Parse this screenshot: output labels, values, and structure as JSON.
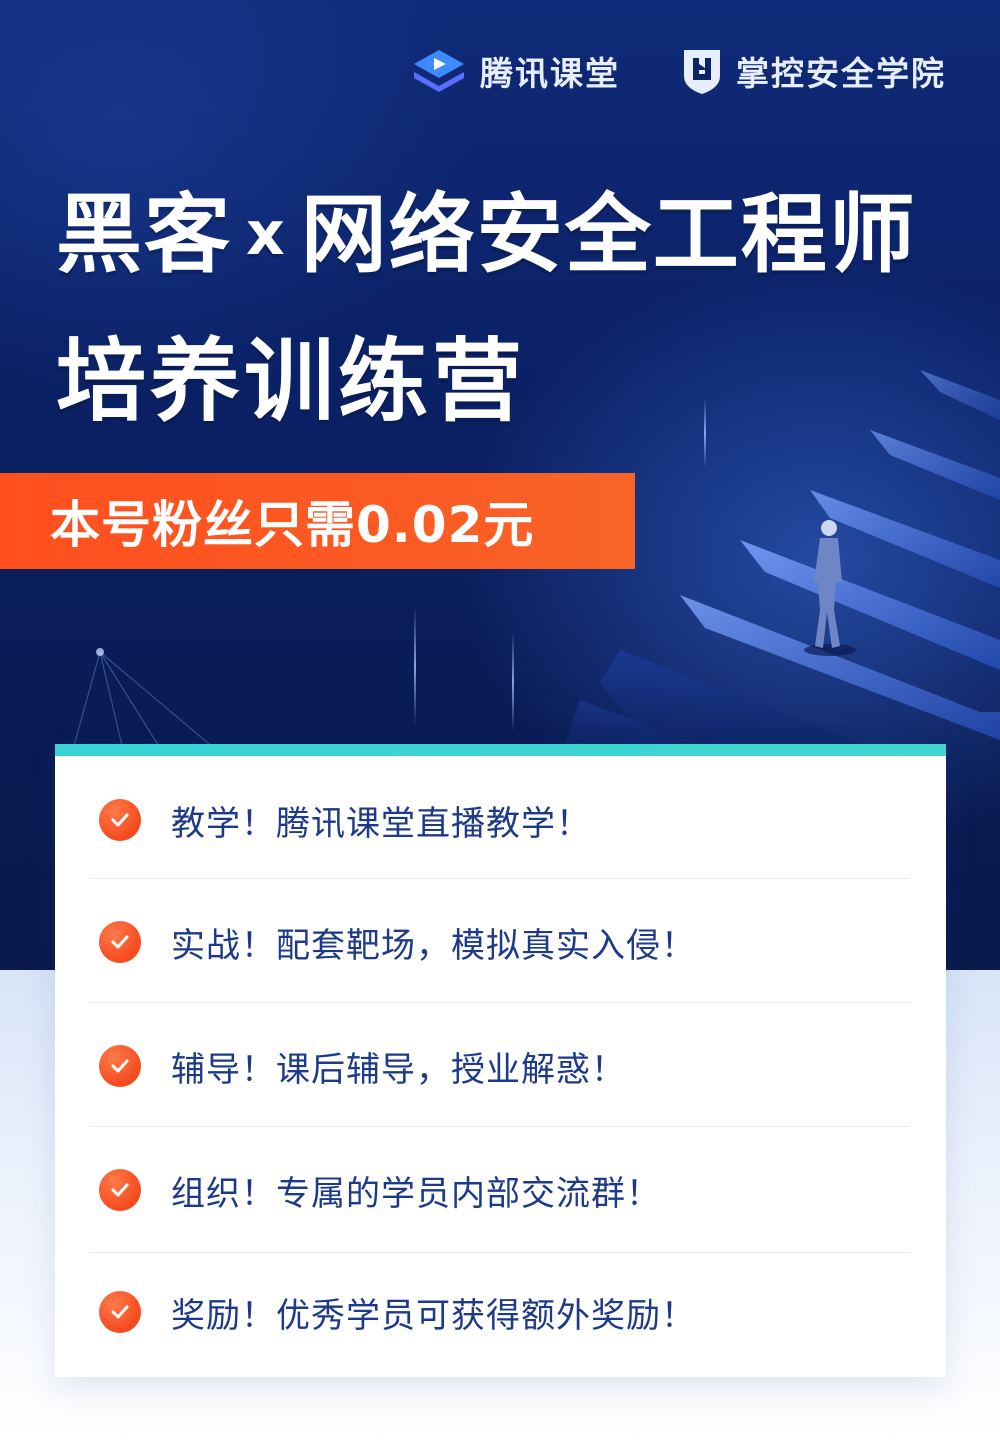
{
  "brands": {
    "tencent": {
      "name": "腾讯课堂",
      "icon": "tencent-classroom-logo-icon"
    },
    "zhangkong": {
      "name": "掌控安全学院",
      "icon": "zhangkong-shield-logo-icon"
    }
  },
  "title": {
    "part_a": "黑客",
    "connector": "x",
    "part_b": "网络安全工程师",
    "line2": "培养训练营"
  },
  "price_banner": "本号粉丝只需0.02元",
  "features": [
    {
      "text": "教学！腾讯课堂直播教学！",
      "icon": "check-icon"
    },
    {
      "text": "实战！配套靶场，模拟真实入侵！",
      "icon": "check-icon"
    },
    {
      "text": "辅导！课后辅导，授业解惑！",
      "icon": "check-icon"
    },
    {
      "text": "组织！专属的学员内部交流群！",
      "icon": "check-icon"
    },
    {
      "text": "奖励！优秀学员可获得额外奖励！",
      "icon": "check-icon"
    }
  ],
  "colors": {
    "hero_bg": "#0b2268",
    "accent_orange": "#ff4f1f",
    "accent_teal": "#38d3d6",
    "feature_text": "#1d3a8a"
  }
}
